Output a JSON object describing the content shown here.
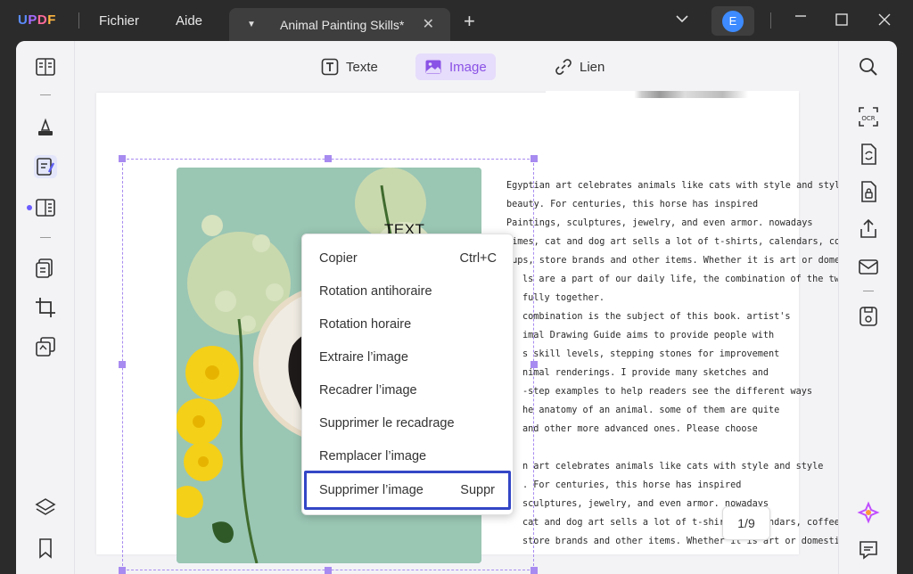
{
  "app": {
    "logo": [
      "U",
      "P",
      "D",
      "F"
    ]
  },
  "menu": {
    "file": "Fichier",
    "help": "Aide"
  },
  "tab": {
    "title": "Animal Painting Skills*",
    "close": "✕"
  },
  "avatar": {
    "initial": "E",
    "color": "#3d8bff"
  },
  "toolbar": {
    "text": "Texte",
    "image": "Image",
    "link": "Lien"
  },
  "image": {
    "overlay_text": "TEXT"
  },
  "body_lines": [
    "Egyptian art celebrates animals like cats with style and style",
    "beauty. For centuries, this horse has inspired",
    "Paintings, sculptures, jewelry, and even armor. nowadays",
    "Times, cat and dog art sells a lot of t-shirts, calendars, coffee",
    "Cups, store brands and other items. Whether it is art or domestic",
    "ls are a part of our daily life, the combination of the two",
    "fully together.",
    "combination is the subject of this book. artist's",
    "imal Drawing Guide aims to provide people with",
    "s skill levels, stepping stones for improvement",
    "nimal renderings. I provide many sketches and",
    "-step examples to help readers see the different ways",
    "he anatomy of an animal. some of them are quite",
    "and other more advanced ones. Please choose",
    "",
    "n art celebrates animals like cats with style and style",
    ". For centuries, this horse has inspired",
    "sculptures, jewelry, and even armor. nowadays",
    "cat and dog art sells a lot of t-shirts, calendars, coffee",
    "store brands and other items. Whether it is art or domestic"
  ],
  "context_menu": [
    {
      "label": "Copier",
      "shortcut": "Ctrl+C"
    },
    {
      "label": "Rotation antihoraire",
      "shortcut": ""
    },
    {
      "label": "Rotation horaire",
      "shortcut": ""
    },
    {
      "label": "Extraire l’image",
      "shortcut": ""
    },
    {
      "label": "Recadrer l’image",
      "shortcut": ""
    },
    {
      "label": "Supprimer le recadrage",
      "shortcut": ""
    },
    {
      "label": "Remplacer l’image",
      "shortcut": ""
    },
    {
      "label": "Supprimer l’image",
      "shortcut": "Suppr"
    }
  ],
  "page_indicator": "1/9",
  "colors": {
    "accent": "#8a52e6",
    "highlight": "#3346c6",
    "selection": "#a88bf0"
  }
}
